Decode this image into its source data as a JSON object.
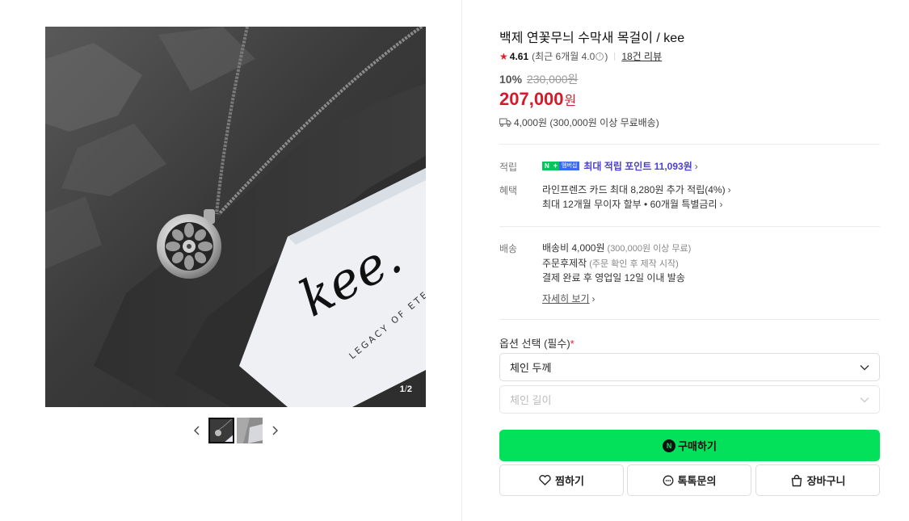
{
  "gallery": {
    "counter_current": "1",
    "counter_total": "2",
    "card_text": "LEGACY OF ETER"
  },
  "product": {
    "title": "백제 연꽃무늬 수막새 목걸이 / kee",
    "rating": "4.61",
    "rating_recent": "(최근 6개월 4.0",
    "rating_recent_end": ")",
    "review_count": "18건 리뷰",
    "discount_rate": "10%",
    "original_price": "230,000원",
    "price": "207,000",
    "price_unit": "원",
    "shipping_summary": "4,000원 (300,000원 이상 무료배송)"
  },
  "benefits": {
    "points_label": "적립",
    "points_badge_n": "N",
    "points_badge_plus": "+",
    "points_badge_m": "멤버십",
    "points_text": "최대 적립 포인트 11,093원",
    "benefit_label": "혜택",
    "benefit_line1": "라인프렌즈 카드 최대 8,280원 추가 적립(4%)",
    "benefit_line2": "최대 12개월 무이자 할부 • 60개월 특별금리"
  },
  "delivery": {
    "label": "배송",
    "fee": "배송비 4,000원",
    "fee_note": "(300,000원 이상 무료)",
    "made_to_order": "주문후제작",
    "made_to_order_note": "(주문 확인 후 제작 시작)",
    "dispatch": "결제 완료 후 영업일 12일 이내 발송",
    "detail_link": "자세히 보기"
  },
  "options": {
    "title": "옵션 선택 (필수)",
    "required_mark": "*",
    "select1": "체인 두께",
    "select2": "체인 길이"
  },
  "actions": {
    "buy": "구매하기",
    "npay": "N",
    "wish": "찜하기",
    "talk": "톡톡문의",
    "cart": "장바구니"
  },
  "colors": {
    "buy_green": "#03e05a",
    "price_red": "#d41a2b",
    "star_red": "#e61e2c",
    "points_purple": "#4b3fd6"
  },
  "icons": [
    "star-icon",
    "info-icon",
    "truck-icon",
    "chevron-right-icon",
    "chevron-down-icon",
    "chevron-left-icon",
    "heart-icon",
    "chat-icon",
    "bag-icon",
    "npay-icon"
  ]
}
